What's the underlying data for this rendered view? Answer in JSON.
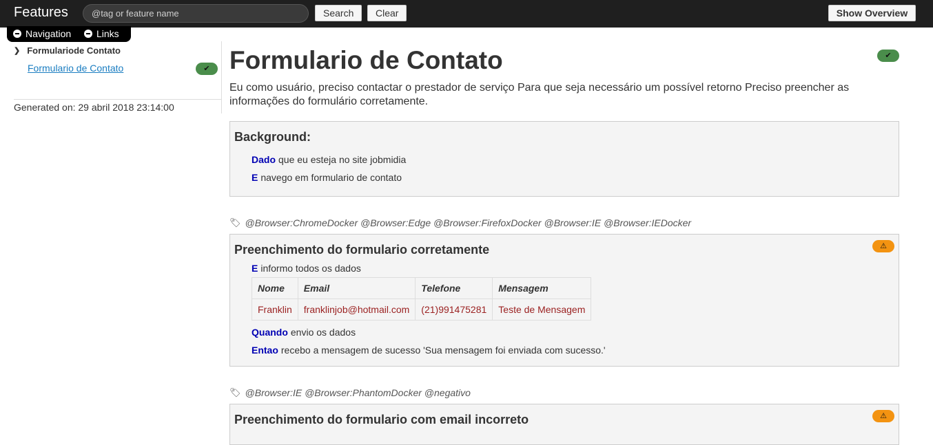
{
  "header": {
    "brand": "Features",
    "search_placeholder": "@tag or feature name",
    "search_label": "Search",
    "clear_label": "Clear",
    "overview_label": "Show Overview"
  },
  "tabs": {
    "navigation": "Navigation",
    "links": "Links"
  },
  "sidebar": {
    "group": "Formulariode Contato",
    "link": "Formulario de Contato",
    "generated": "Generated on: 29 abril 2018 23:14:00"
  },
  "feature": {
    "title": "Formulario de Contato",
    "description": "Eu como usuário, preciso contactar o prestador de serviço Para que seja necessário um possível retorno Preciso preencher as informações do formulário corretamente."
  },
  "background": {
    "heading": "Background:",
    "steps": [
      {
        "keyword": "Dado",
        "text": "que eu esteja no site jobmidia"
      },
      {
        "keyword": "E",
        "text": "navego em formulario de contato"
      }
    ]
  },
  "scenario1": {
    "tags": "@Browser:ChromeDocker @Browser:Edge @Browser:FirefoxDocker @Browser:IE @Browser:IEDocker",
    "title": "Preenchimento do formulario corretamente",
    "step1": {
      "keyword": "E",
      "text": "informo todos os dados"
    },
    "table": {
      "headers": [
        "Nome",
        "Email",
        "Telefone",
        "Mensagem"
      ],
      "row": [
        "Franklin",
        "franklinjob@hotmail.com",
        "(21)991475281",
        "Teste de Mensagem"
      ]
    },
    "step2": {
      "keyword": "Quando",
      "text": "envio os dados"
    },
    "step3": {
      "keyword": "Entao",
      "text": "recebo a mensagem de sucesso 'Sua mensagem foi enviada com sucesso.'"
    }
  },
  "scenario2": {
    "tags": "@Browser:IE @Browser:PhantomDocker @negativo",
    "title": "Preenchimento do formulario com email incorreto"
  },
  "colors": {
    "ok": "#4a8d4b",
    "warn": "#f39311",
    "keyword": "#0000b3",
    "table_value": "#9b2222"
  },
  "icons": {
    "passed": "check-icon",
    "pending": "warning-icon",
    "tag": "tag-icon"
  }
}
